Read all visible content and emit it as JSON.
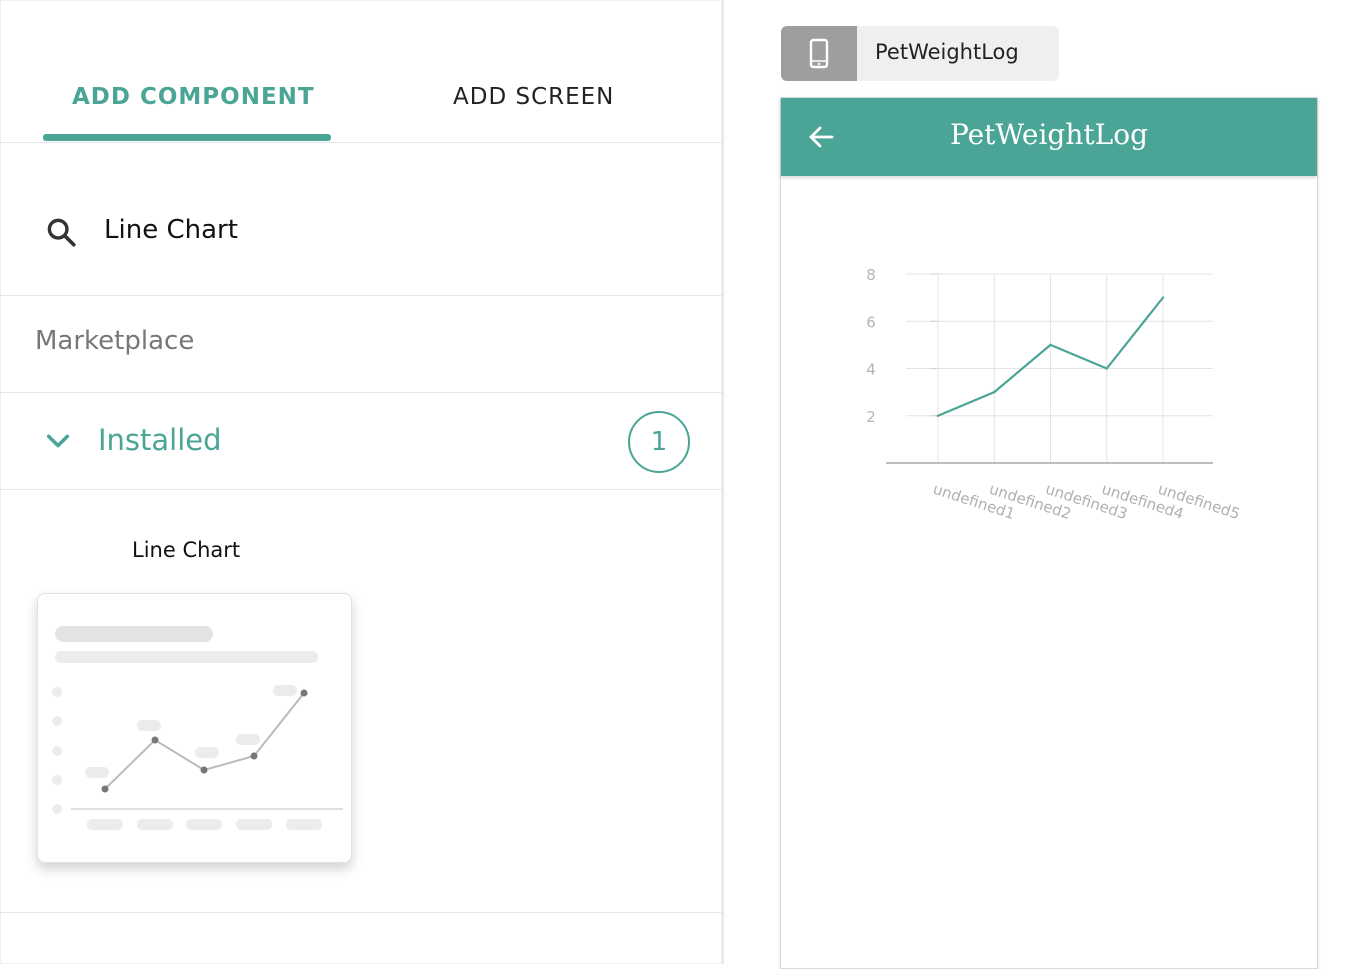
{
  "tabs": {
    "add_component": "ADD COMPONENT",
    "add_screen": "ADD SCREEN"
  },
  "search": {
    "value": "Line Chart"
  },
  "sections": {
    "marketplace": "Marketplace",
    "installed": "Installed",
    "installed_count": "1"
  },
  "component": {
    "title": "Line Chart"
  },
  "screen": {
    "chip_label": "PetWeightLog",
    "app_title": "PetWeightLog"
  },
  "colors": {
    "accent": "#4aa596",
    "chip_icon_bg": "#9e9e9e"
  },
  "icons": {
    "search": "search-icon",
    "chevron": "chevron-down-icon",
    "phone": "phone-icon",
    "back": "arrow-back-icon"
  },
  "chart_data": {
    "type": "line",
    "categories": [
      "undefined1",
      "undefined2",
      "undefined3",
      "undefined4",
      "undefined5"
    ],
    "values": [
      2,
      3,
      5,
      4,
      7
    ],
    "yticks": [
      2,
      4,
      6,
      8
    ],
    "ylim": [
      0,
      8
    ],
    "grid": true,
    "title": "",
    "xlabel": "",
    "ylabel": "",
    "line_color": "#4aa596"
  }
}
